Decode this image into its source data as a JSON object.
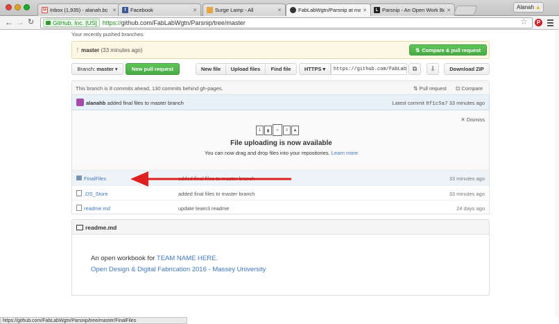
{
  "browser": {
    "tabs": [
      {
        "title": "Inbox (1,935) - alanah.bc",
        "icon": "gmail-icon",
        "color": "#d44638"
      },
      {
        "title": "Facebook",
        "icon": "facebook-icon",
        "color": "#3b5998"
      },
      {
        "title": "Surge Lamp - All",
        "icon": "etsy-icon",
        "color": "#e8a53c"
      },
      {
        "title": "FabLabWgtn/Parsnip at ma",
        "icon": "github-icon",
        "color": "#333333"
      },
      {
        "title": "Parsnip - An Open Work Bo",
        "icon": "l-icon",
        "color": "#222222"
      }
    ],
    "profile_name": "Alanah",
    "site_identity": "GitHub, Inc. [US]",
    "url_scheme": "https://",
    "url_rest": "github.com/FabLabWgtn/Parsnip/tree/master",
    "status_url": "https://github.com/FabLabWgtn/Parsnip/tree/master/FinalFiles"
  },
  "recent": {
    "label": "Your recently pushed branches:",
    "branch": "master",
    "age": "(33 minutes ago)",
    "compare_button": "Compare & pull request"
  },
  "toolbar": {
    "branch_prefix": "Branch:",
    "branch_name": "master",
    "new_pr": "New pull request",
    "new_file": "New file",
    "upload_files": "Upload files",
    "find_file": "Find file",
    "protocol": "HTTPS",
    "clone_url": "https://github.com/FabLab",
    "download_zip": "Download ZIP"
  },
  "ahead": {
    "text": "This branch is 8 commits ahead, 130 commits behind gh-pages.",
    "pull_request": "Pull request",
    "compare": "Compare"
  },
  "commit": {
    "author": "alanahb",
    "message": "added final files to master branch",
    "latest_label": "Latest commit",
    "sha": "8f1c5a7",
    "age": "33 minutes ago"
  },
  "upload": {
    "dismiss": "Dismiss",
    "title": "File uploading is now available",
    "subtitle": "You can now drag and drop files into your repositories.",
    "learn_more": "Learn more"
  },
  "files": [
    {
      "name": "FinalFiles",
      "type": "folder",
      "message": "added final files to master branch",
      "age": "33 minutes ago"
    },
    {
      "name": ".DS_Store",
      "type": "file",
      "message": "added final files to master branch",
      "age": "33 minutes ago"
    },
    {
      "name": "readme.md",
      "type": "file",
      "message": "update team3 readme",
      "age": "24 days ago"
    }
  ],
  "readme": {
    "title": "readme.md",
    "line1_prefix": "An open workbook for",
    "line1_link": "TEAM NAME HERE.",
    "line2": "Open Design & Digital Fabrication 2016 - Massey University"
  },
  "colors": {
    "annotation_arrow": "#e02020",
    "link": "#4078c0",
    "green_button": "#55bb50"
  }
}
